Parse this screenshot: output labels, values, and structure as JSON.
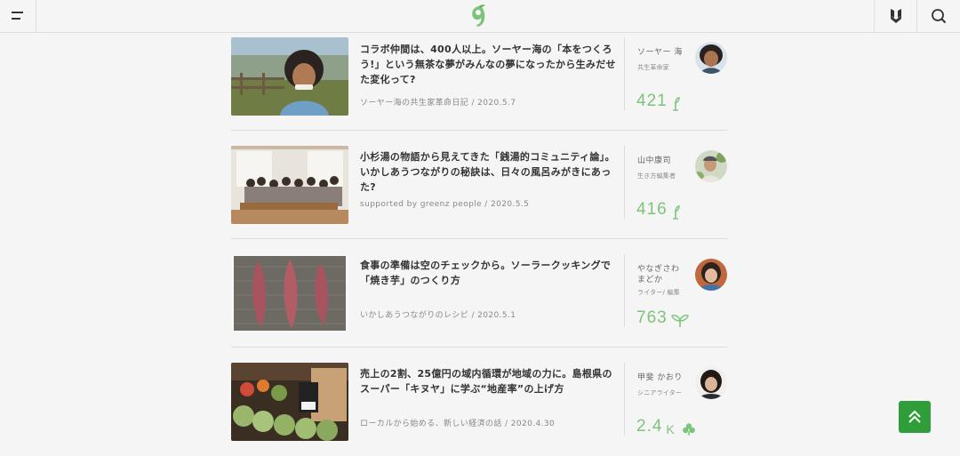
{
  "header": {
    "menu_icon": "hamburger-menu-icon",
    "logo_icon": "greenz-leaf-logo",
    "badge_icon": "badge-shield-icon",
    "search_icon": "search-icon",
    "brand_color": "#7cc47a"
  },
  "articles": [
    {
      "title": "コラボ仲間は、400人以上。ソーヤー海の「本をつくろう!」という無茶な夢がみんなの夢になったから生みだせた変化って?",
      "meta": "ソーヤー海の共生家革命日記 / 2020.5.7",
      "author_name": "ソーヤー 海",
      "author_role": "共生革命家",
      "count": "421",
      "count_unit": "",
      "count_icon": "sprout-stem-icon"
    },
    {
      "title": "小杉湯の物語から見えてきた「銭湯的コミュニティ論」。いかしあうつながりの秘訣は、日々の風呂みがきにあった?",
      "meta": "supported by greenz people / 2020.5.5",
      "author_name": "山中康司",
      "author_role": "生き方編集者",
      "count": "416",
      "count_unit": "",
      "count_icon": "sprout-stem-icon"
    },
    {
      "title": "食事の準備は空のチェックから。ソーラークッキングで「焼き芋」のつくり方",
      "meta": "いかしあうつながりのレシピ / 2020.5.1",
      "author_name": "やなぎさわ まどか",
      "author_role": "ライター/ 編集",
      "count": "763",
      "count_unit": "",
      "count_icon": "two-leaf-sprout-icon"
    },
    {
      "title": "売上の2割、25億円の域内循環が地域の力に。島根県のスーパー「キヌヤ」に学ぶ“地産率”の上げ方",
      "meta": "ローカルから始める、新しい経済の話 / 2020.4.30",
      "author_name": "甲斐 かおり",
      "author_role": "シニアライター",
      "count": "2.4",
      "count_unit": "K",
      "count_icon": "clover-icon"
    }
  ],
  "to_top_icon": "chevron-up-icon"
}
